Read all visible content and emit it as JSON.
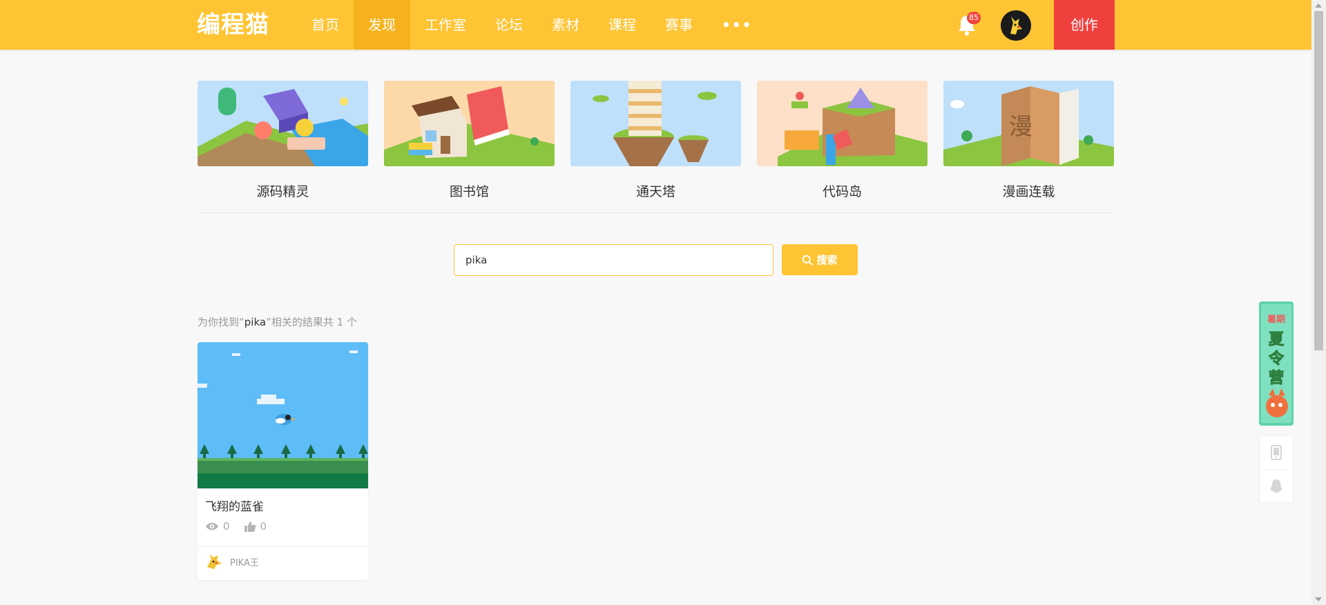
{
  "header": {
    "logo": "编程猫",
    "nav": [
      {
        "label": "首页",
        "active": false
      },
      {
        "label": "发现",
        "active": true
      },
      {
        "label": "工作室",
        "active": false
      },
      {
        "label": "论坛",
        "active": false
      },
      {
        "label": "素材",
        "active": false
      },
      {
        "label": "课程",
        "active": false
      },
      {
        "label": "赛事",
        "active": false
      },
      {
        "label": "•••",
        "active": false
      }
    ],
    "notification_count": "85",
    "create_label": "创作"
  },
  "features": [
    {
      "label": "源码精灵"
    },
    {
      "label": "图书馆"
    },
    {
      "label": "通天塔"
    },
    {
      "label": "代码岛"
    },
    {
      "label": "漫画连载"
    }
  ],
  "search": {
    "value": "pika",
    "button_label": "搜索"
  },
  "results": {
    "prefix": "为你找到“",
    "keyword": "pika",
    "suffix": "”相关的结果共 1 个",
    "items": [
      {
        "title": "飞翔的蓝雀",
        "views": "0",
        "likes": "0",
        "author": "PIKA王"
      }
    ]
  },
  "float": {
    "banner_text": "暑期夏令营"
  },
  "colors": {
    "brand": "#fec433",
    "nav_active": "#f5b21c",
    "create": "#f0403e",
    "badge": "#f2453d"
  }
}
